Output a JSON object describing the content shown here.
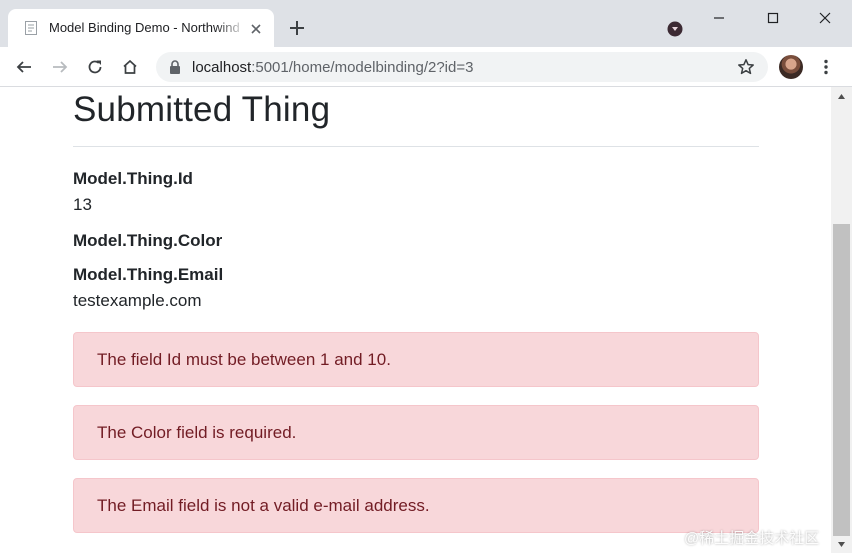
{
  "browser": {
    "tab": {
      "title": "Model Binding Demo - Northwind"
    },
    "address_bar": {
      "host": "localhost",
      "path": ":5001/home/modelbinding/2?id=3"
    },
    "icons": {
      "favicon": "document-icon",
      "tab_close": "close-icon",
      "new_tab": "plus-icon",
      "back": "arrow-left-icon",
      "forward": "arrow-right-icon",
      "reload": "reload-icon",
      "home": "home-icon",
      "lock": "lock-icon",
      "bookmark": "star-icon",
      "menu": "kebab-menu-icon"
    }
  },
  "page": {
    "heading": "Submitted Thing",
    "fields": [
      {
        "label": "Model.Thing.Id",
        "value": "13"
      },
      {
        "label": "Model.Thing.Color",
        "value": ""
      },
      {
        "label": "Model.Thing.Email",
        "value": "testexample.com"
      }
    ],
    "errors": [
      "The field Id must be between 1 and 10.",
      "The Color field is required.",
      "The Email field is not a valid e-mail address."
    ]
  },
  "colors": {
    "alert_background": "#f8d7da",
    "alert_border": "#f5c6cb",
    "alert_text": "#721c24",
    "text": "#212529"
  },
  "watermark": "@稀土掘金技术社区"
}
